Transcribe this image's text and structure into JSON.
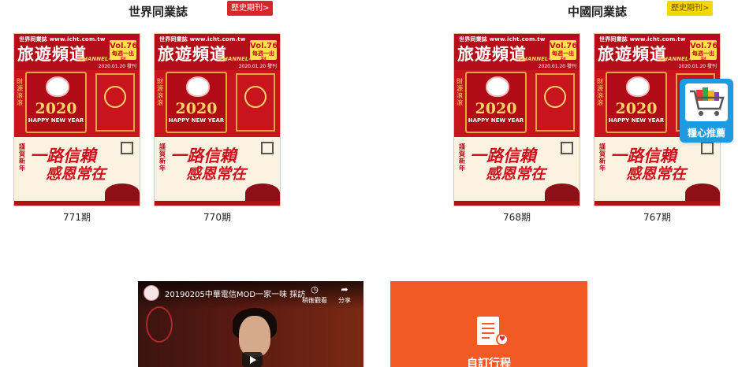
{
  "world_section": {
    "title": "世界同業誌",
    "history_button": "歷史期刊>",
    "issues": [
      {
        "label": "771期",
        "url_text": "世界同業誌 www.icht.com.tw",
        "magazine": "旅遊頻道",
        "subtitle": "CHANNEL-T",
        "vol": "Vol.768",
        "freq": "每週一出刊",
        "date": "2020.01.20 發刊"
      },
      {
        "label": "770期",
        "url_text": "世界同業誌 www.icht.com.tw",
        "magazine": "旅遊頻道",
        "subtitle": "CHANNEL-T",
        "vol": "Vol.768",
        "freq": "每週一出刊",
        "date": "2020.01.20 發刊"
      }
    ]
  },
  "china_section": {
    "title": "中國同業誌",
    "history_button": "歷史期刊>",
    "issues": [
      {
        "label": "768期",
        "url_text": "世界同業誌 www.icht.com.tw",
        "magazine": "旅遊頻道",
        "subtitle": "CHANNEL-T",
        "vol": "Vol.768",
        "freq": "每週一出刊",
        "date": "2020.01.20 發刊"
      },
      {
        "label": "767期",
        "url_text": "世界同業誌 www.icht.com.tw",
        "magazine": "旅遊頻道",
        "subtitle": "CHANNEL-T",
        "vol": "Vol.768",
        "freq": "每週一出刊",
        "date": "2020.01.20 發刊"
      }
    ]
  },
  "cover_art": {
    "year": "2020",
    "new_year": "HAPPY NEW YEAR",
    "greeting_line_1": "一路信賴",
    "greeting_line_2": "感恩常在"
  },
  "floating_widget": {
    "label": "糧心推薦",
    "icon": "shopping-cart-icon"
  },
  "video": {
    "title": "20190205中華電信MOD一家一味 採訪",
    "watch_later": "稍後觀看",
    "share": "分享"
  },
  "itinerary_card": {
    "label": "自訂行程",
    "icon": "document-heart-icon",
    "color": "#f15a24"
  },
  "colors": {
    "red_button": "#d8262f",
    "yellow_button": "#f4d600",
    "widget_blue": "#1e9ae0"
  }
}
